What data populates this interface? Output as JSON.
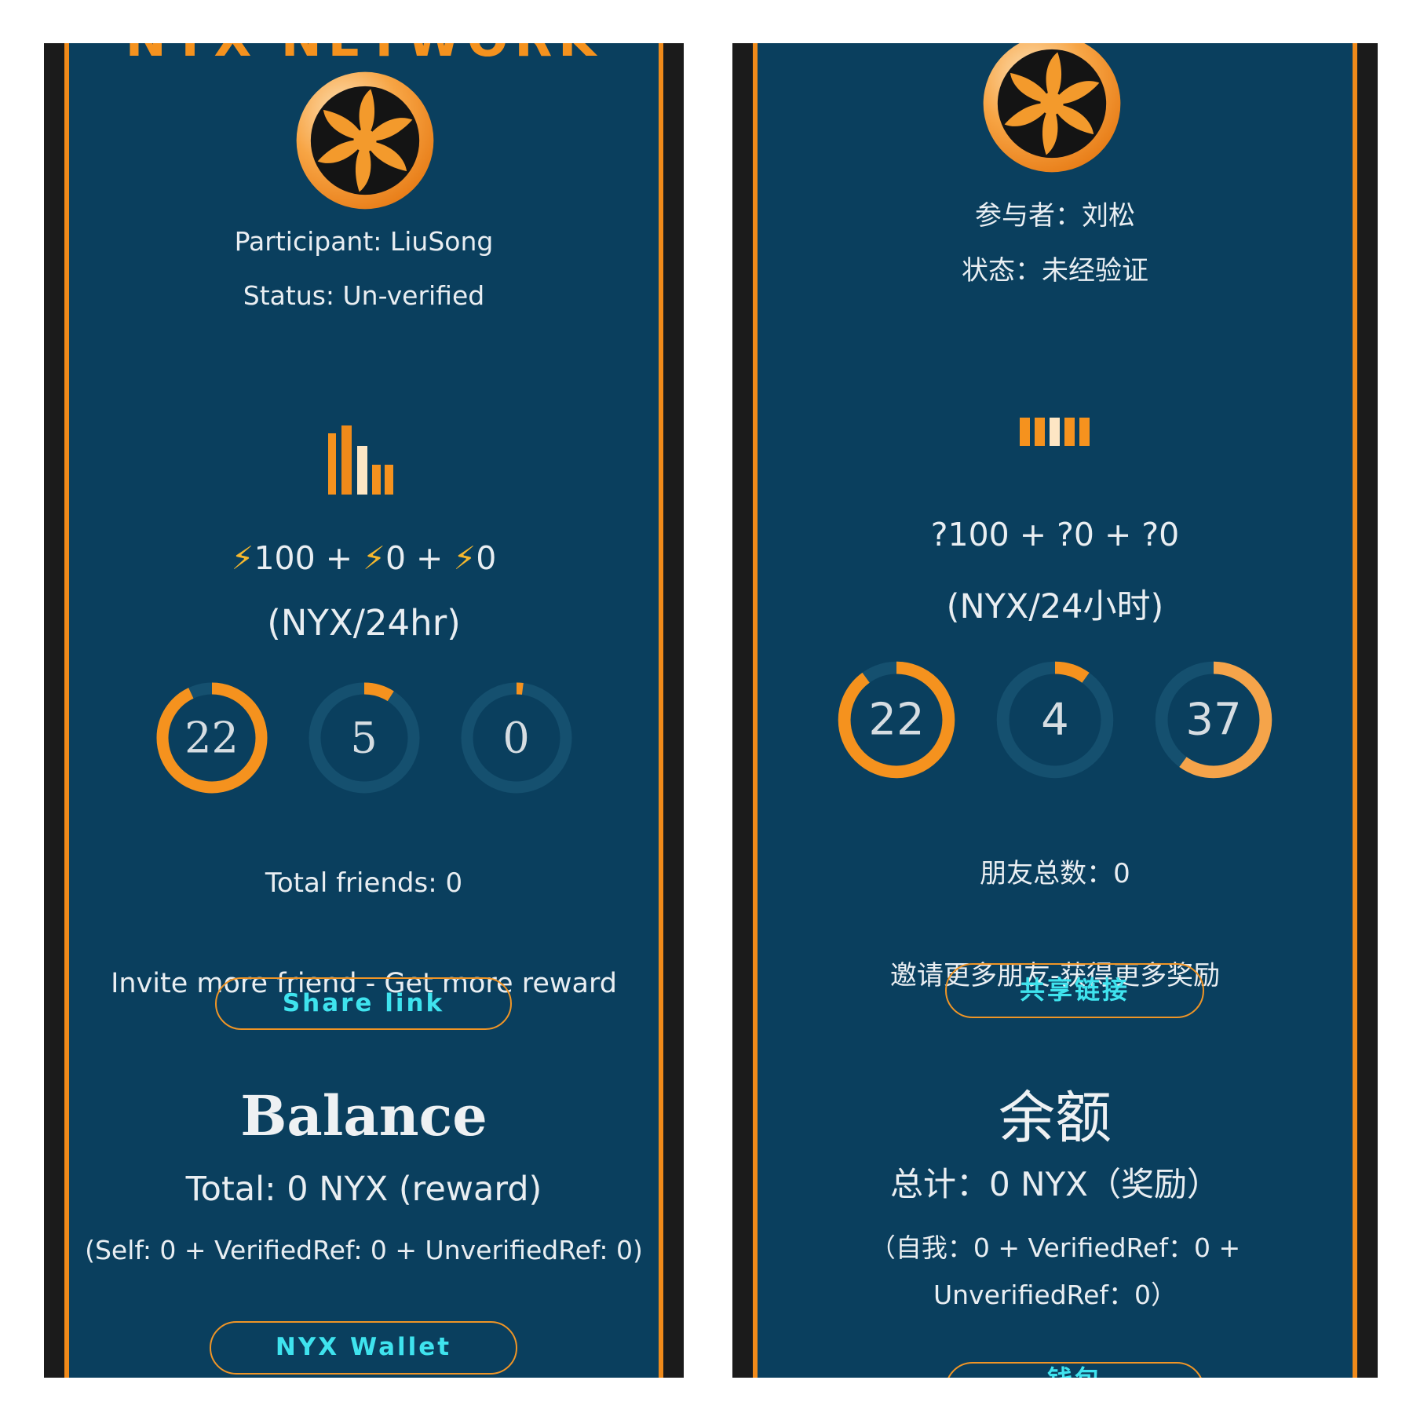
{
  "colors": {
    "panel_bg": "#0a3f5e",
    "accent": "#f5921e",
    "button_text": "#3fe3ee",
    "frame": "#1b1b1b"
  },
  "english": {
    "brand": "NYX NETWORK",
    "participant": "Participant: LiuSong",
    "status": "Status: Un-verified",
    "rate_parts": [
      "100 +",
      "0 +",
      "0"
    ],
    "rate_icon": "lightning-bolt-icon",
    "rate_unit": "(NYX/24hr)",
    "rings": [
      {
        "value": "22",
        "fill": 0.93
      },
      {
        "value": "5",
        "fill": 0.09
      },
      {
        "value": "0",
        "fill": 0.02
      }
    ],
    "total_friends": "Total friends: 0",
    "invite": "Invite more friend - Get more reward",
    "share_button": "Share link",
    "balance_title": "Balance",
    "balance_total": "Total: 0 NYX (reward)",
    "balance_breakdown": "(Self: 0 + VerifiedRef: 0 + UnverifiedRef: 0)",
    "wallet_button": "NYX Wallet"
  },
  "chinese": {
    "participant": "参与者：刘松",
    "status": "状态：未经验证",
    "rate": "?100 + ?0 + ?0",
    "rate_unit": "(NYX/24小时)",
    "rings": [
      {
        "value": "22",
        "fill": 0.9
      },
      {
        "value": "4",
        "fill": 0.1
      },
      {
        "value": "37",
        "fill": 0.6
      }
    ],
    "total_friends": "朋友总数：0",
    "invite": "邀请更多朋友-获得更多奖励",
    "share_button": "共享链接",
    "balance_title": "余额",
    "balance_total": "总计：0 NYX（奖励）",
    "balance_breakdown_1": "（自我：0 + VerifiedRef：0 +",
    "balance_breakdown_2": "UnverifiedRef：0）",
    "wallet_button_partial": "钱包"
  }
}
